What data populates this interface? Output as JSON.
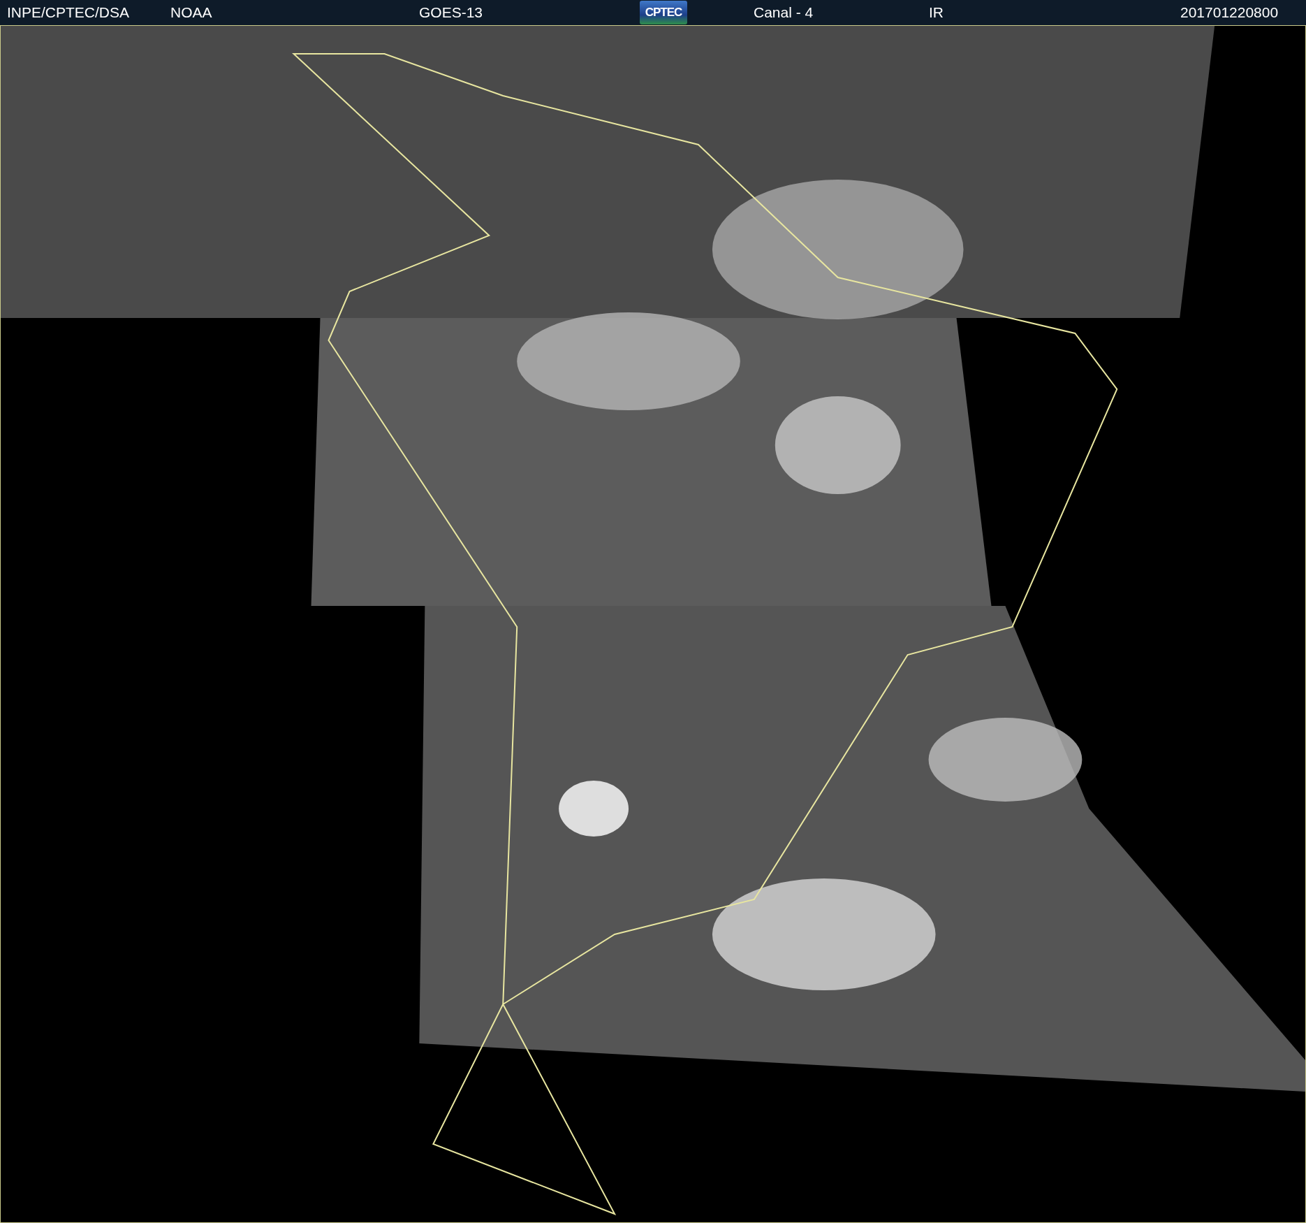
{
  "header": {
    "items": [
      {
        "kind": "text",
        "text": "INPE/CPTEC/DSA"
      },
      {
        "kind": "text",
        "text": "NOAA"
      },
      {
        "kind": "text",
        "text": "GOES-13"
      },
      {
        "kind": "logo",
        "text": "CPTEC"
      },
      {
        "kind": "text",
        "text": "Canal - 4"
      },
      {
        "kind": "text",
        "text": "IR"
      },
      {
        "kind": "text",
        "text": "201701220800"
      }
    ]
  }
}
